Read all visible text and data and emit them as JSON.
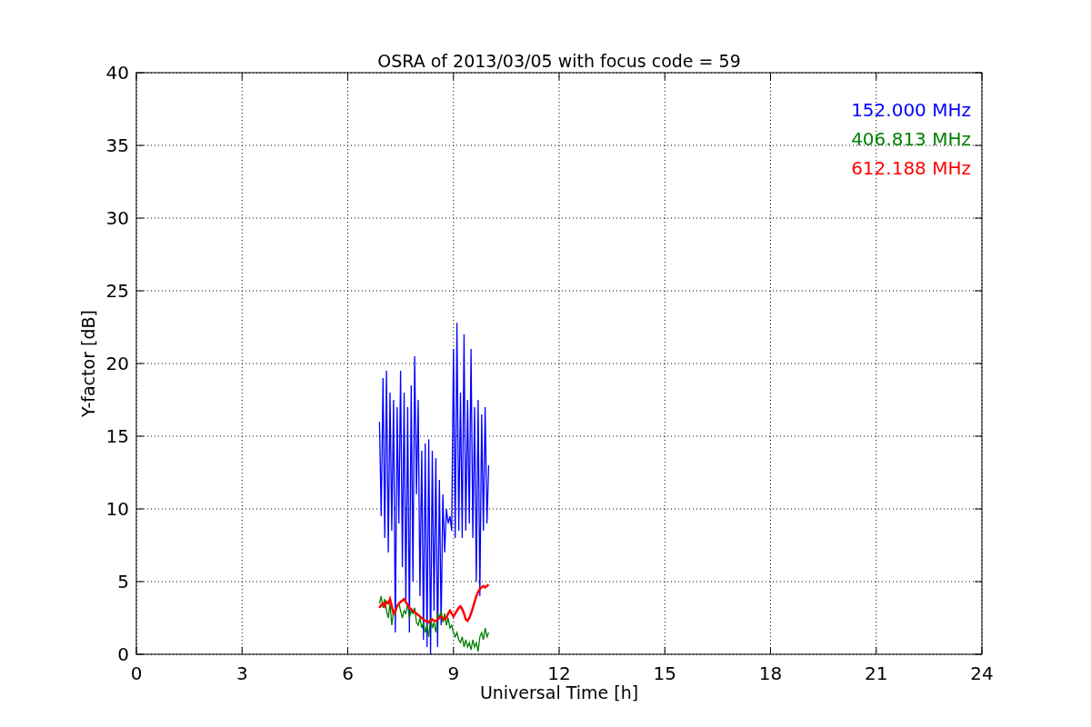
{
  "chart_data": {
    "type": "line",
    "grid": true,
    "title": "OSRA of 2013/03/05 with focus code = 59",
    "xlabel": "Universal Time [h]",
    "ylabel": "Y-factor [dB]",
    "xlim": [
      0,
      24
    ],
    "ylim": [
      0,
      40
    ],
    "xticks": [
      0,
      3,
      6,
      9,
      12,
      15,
      18,
      21,
      24
    ],
    "yticks": [
      0,
      5,
      10,
      15,
      20,
      25,
      30,
      35,
      40
    ],
    "x": [
      6.9,
      6.95,
      7.0,
      7.05,
      7.1,
      7.15,
      7.2,
      7.25,
      7.3,
      7.35,
      7.4,
      7.45,
      7.5,
      7.55,
      7.6,
      7.65,
      7.7,
      7.75,
      7.8,
      7.85,
      7.9,
      7.95,
      8.0,
      8.05,
      8.1,
      8.15,
      8.2,
      8.25,
      8.3,
      8.35,
      8.4,
      8.45,
      8.5,
      8.55,
      8.6,
      8.65,
      8.7,
      8.75,
      8.8,
      8.85,
      8.9,
      8.95,
      9.0,
      9.05,
      9.1,
      9.15,
      9.2,
      9.25,
      9.3,
      9.35,
      9.4,
      9.45,
      9.5,
      9.55,
      9.6,
      9.65,
      9.7,
      9.75,
      9.8,
      9.85,
      9.9,
      9.95,
      10.0
    ],
    "series": [
      {
        "name": "152.000 MHz",
        "color": "#0000ff",
        "values": [
          16,
          9.5,
          19,
          8,
          19.5,
          7,
          18,
          8.5,
          17.5,
          1.5,
          17,
          9,
          19.5,
          6,
          18,
          3.5,
          17,
          1.5,
          18.5,
          5,
          20.5,
          11,
          17.5,
          4,
          14,
          1,
          14.5,
          0.5,
          14.8,
          0,
          14,
          3,
          13.5,
          0.5,
          12,
          2,
          11,
          7,
          10,
          9,
          9.5,
          8.5,
          21,
          8,
          22.8,
          8.5,
          18,
          8,
          22,
          8.5,
          17.5,
          9,
          21,
          8,
          17,
          5,
          17.5,
          4,
          16.5,
          8.5,
          17,
          9,
          13
        ]
      },
      {
        "name": "406.813 MHz",
        "color": "#008000",
        "values": [
          3.5,
          4,
          3.2,
          3.8,
          3,
          2.5,
          3.5,
          2,
          3,
          2.8,
          3.3,
          3.5,
          3,
          2.5,
          3,
          2.8,
          3.5,
          2.5,
          3,
          2.8,
          3.2,
          2.2,
          2,
          2.5,
          1.8,
          2.2,
          1.5,
          2,
          1.2,
          2.5,
          1.8,
          2.2,
          1.5,
          2.8,
          2.5,
          3,
          2.2,
          2.8,
          2,
          2.5,
          1.8,
          2,
          1.5,
          1.2,
          1.5,
          1,
          0.8,
          1.2,
          0.5,
          1,
          0.5,
          0.8,
          0.3,
          1,
          0.5,
          0.8,
          0.2,
          1.2,
          1.5,
          1,
          1.8,
          1.2,
          1.5
        ]
      },
      {
        "name": "612.188 MHz",
        "color": "#ff0000",
        "values": [
          3.2,
          3.4,
          3.5,
          3.3,
          3.6,
          3.5,
          3.8,
          3.3,
          2.8,
          3.0,
          3.3,
          3.5,
          3.6,
          3.7,
          3.8,
          3.6,
          3.4,
          3.2,
          3.1,
          3.0,
          2.9,
          2.8,
          2.7,
          2.6,
          2.5,
          2.4,
          2.3,
          2.3,
          2.2,
          2.3,
          2.4,
          2.3,
          2.3,
          2.4,
          2.5,
          2.6,
          2.5,
          2.4,
          2.5,
          2.8,
          3.0,
          2.8,
          2.6,
          2.8,
          3.0,
          3.2,
          3.3,
          3.1,
          2.8,
          2.4,
          2.3,
          2.5,
          2.8,
          3.2,
          3.6,
          4.0,
          4.3,
          4.5,
          4.6,
          4.7,
          4.6,
          4.7,
          4.8
        ]
      }
    ]
  }
}
